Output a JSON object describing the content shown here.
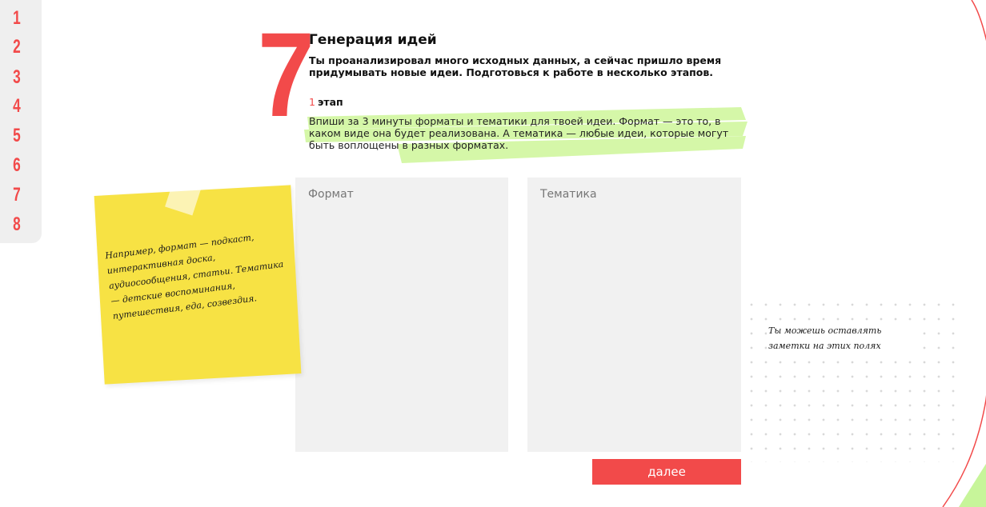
{
  "nav": {
    "steps": [
      "1",
      "2",
      "3",
      "4",
      "5",
      "6",
      "7",
      "8"
    ]
  },
  "section": {
    "number": "7",
    "title": "Генерация идей",
    "intro": "Ты проанализировал много исходных данных, а сейчас пришло время придумывать новые идеи. Подготовься к работе в несколько этапов.",
    "stage_number": "1",
    "stage_label": "этап",
    "task": "Впиши за 3 минуты форматы и тематики для твоей идеи. Формат — это то, в каком виде она будет реализована. А тематика — любые идеи, которые могут быть воплощены в разных форматах."
  },
  "fields": {
    "format_placeholder": "Формат",
    "format_value": "",
    "topic_placeholder": "Тематика",
    "topic_value": ""
  },
  "sticky": {
    "text": "Например, формат — подкаст, интерактивная доска, аудиосообщения, статьи. Тематика — детские воспоминания, путешествия, еда, созвездия."
  },
  "side_note": {
    "text": "Ты можешь оставлять заметки на этих полях"
  },
  "next_button": {
    "label": "далее"
  },
  "colors": {
    "accent": "#f24a4a",
    "highlight": "#d5f7a8",
    "sticky": "#f7e244",
    "field_bg": "#f1f1f1",
    "nav_bg": "#efefef"
  }
}
